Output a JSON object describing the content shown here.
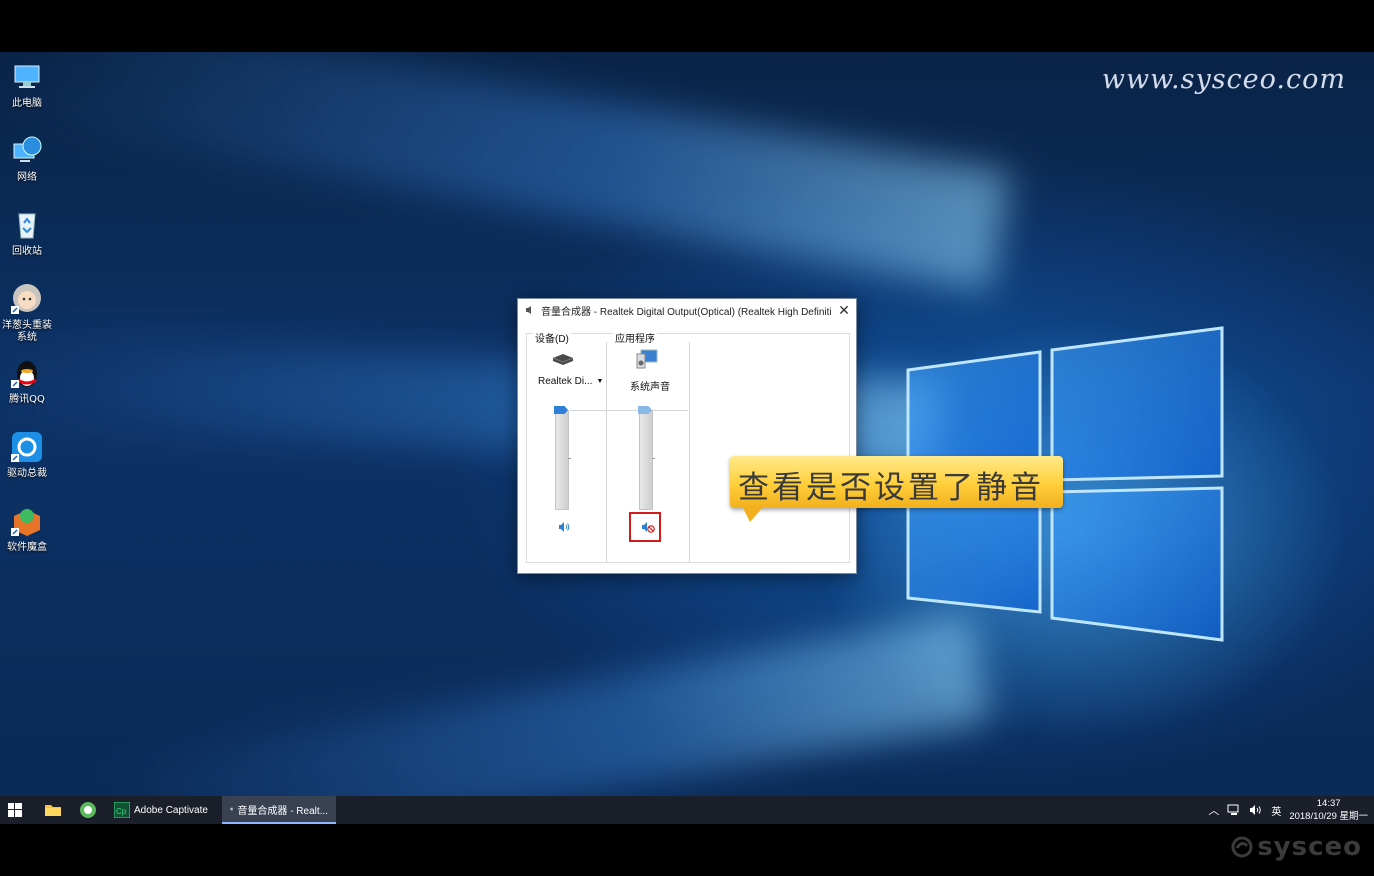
{
  "watermark": {
    "url": "www.sysceo.com",
    "brand": "sysceo"
  },
  "desktop_icons": [
    {
      "label": "此电脑",
      "icon": "computer-icon"
    },
    {
      "label": "网络",
      "icon": "network-icon"
    },
    {
      "label": "回收站",
      "icon": "recycle-bin-icon"
    },
    {
      "label": "洋葱头重装系统",
      "icon": "onion-reinstall-icon"
    },
    {
      "label": "腾讯QQ",
      "icon": "qq-icon"
    },
    {
      "label": "驱动总裁",
      "icon": "driver-icon"
    },
    {
      "label": "软件魔盒",
      "icon": "software-box-icon"
    }
  ],
  "mixer": {
    "title": "音量合成器 - Realtek Digital Output(Optical) (Realtek High Definition ...",
    "device_label": "设备(D)",
    "apps_label": "应用程序",
    "device_name": "Realtek Di...",
    "app_name": "系统声音",
    "device_volume": 1.0,
    "app_volume": 1.0,
    "app_muted": true
  },
  "callout": {
    "text": "查看是否设置了静音"
  },
  "taskbar": {
    "apps": [
      {
        "label": "Adobe Captivate",
        "icon": "captivate-icon"
      },
      {
        "label": "音量合成器 - Realt...",
        "icon": "mixer-icon"
      }
    ],
    "ime": "英",
    "time": "14:37",
    "date": "2018/10/29 星期一"
  },
  "colors": {
    "accent": "#2f7fd6",
    "highlight": "#d11a1a",
    "callout": "#ffcf3a"
  }
}
